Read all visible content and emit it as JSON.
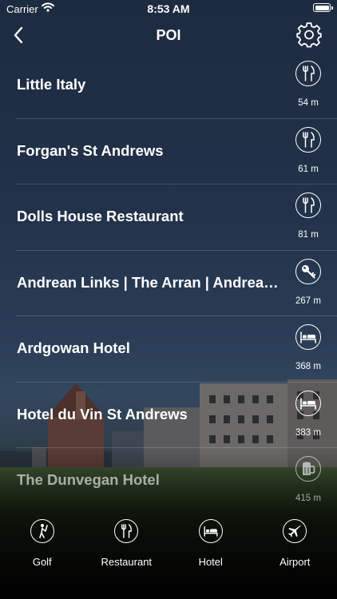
{
  "status_bar": {
    "carrier": "Carrier",
    "time": "8:53 AM"
  },
  "nav": {
    "title": "POI"
  },
  "poi_items": [
    {
      "name": "Little Italy",
      "distance": "54 m",
      "category": "restaurant",
      "icon": "fork-knife-icon"
    },
    {
      "name": "Forgan's St Andrews",
      "distance": "61 m",
      "category": "restaurant",
      "icon": "fork-knife-icon"
    },
    {
      "name": "Dolls House Restaurant",
      "distance": "81 m",
      "category": "restaurant",
      "icon": "fork-knife-icon"
    },
    {
      "name": "Andrean Links | The Arran | Andrean Links",
      "distance": "267 m",
      "category": "rental",
      "icon": "key-icon"
    },
    {
      "name": "Ardgowan Hotel",
      "distance": "368 m",
      "category": "hotel",
      "icon": "bed-icon"
    },
    {
      "name": "Hotel du Vin St Andrews",
      "distance": "383 m",
      "category": "hotel",
      "icon": "bed-icon"
    },
    {
      "name": "The Dunvegan Hotel",
      "distance": "415 m",
      "category": "pub",
      "icon": "beer-mug-icon"
    }
  ],
  "tabs": [
    {
      "label": "Golf",
      "icon": "golfer-icon"
    },
    {
      "label": "Restaurant",
      "icon": "fork-knife-icon"
    },
    {
      "label": "Hotel",
      "icon": "bed-icon"
    },
    {
      "label": "Airport",
      "icon": "airplane-icon"
    }
  ],
  "colors": {
    "background": "#1e2c42",
    "foreground": "#ffffff",
    "divider": "#ffffff29"
  }
}
